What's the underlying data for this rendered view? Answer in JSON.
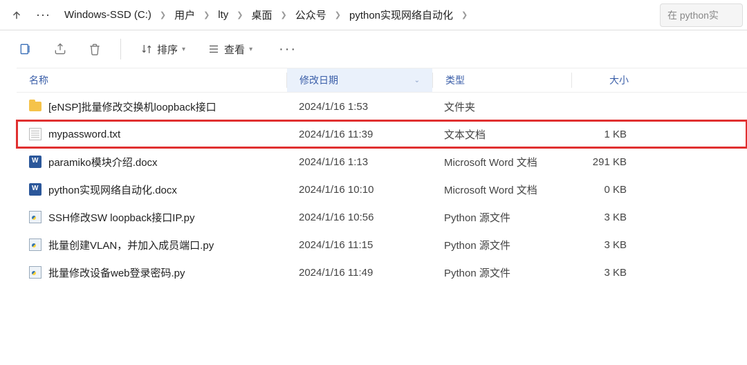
{
  "breadcrumb": {
    "items": [
      {
        "label": "Windows-SSD (C:)"
      },
      {
        "label": "用户"
      },
      {
        "label": "lty"
      },
      {
        "label": "桌面"
      },
      {
        "label": "公众号"
      },
      {
        "label": "python实现网络自动化"
      }
    ],
    "overflow": "···"
  },
  "search": {
    "placeholder": "在 python实"
  },
  "toolbar": {
    "sort_label": "排序",
    "view_label": "查看",
    "more": "···"
  },
  "columns": {
    "name": "名称",
    "date": "修改日期",
    "type": "类型",
    "size": "大小"
  },
  "files": [
    {
      "icon": "folder",
      "name": "[eNSP]批量修改交换机loopback接口",
      "date": "2024/1/16 1:53",
      "type": "文件夹",
      "size": "",
      "highlight": false
    },
    {
      "icon": "txt",
      "name": "mypassword.txt",
      "date": "2024/1/16 11:39",
      "type": "文本文档",
      "size": "1 KB",
      "highlight": true
    },
    {
      "icon": "docx",
      "name": "paramiko模块介绍.docx",
      "date": "2024/1/16 1:13",
      "type": "Microsoft Word 文档",
      "size": "291 KB",
      "highlight": false
    },
    {
      "icon": "docx",
      "name": "python实现网络自动化.docx",
      "date": "2024/1/16 10:10",
      "type": "Microsoft Word 文档",
      "size": "0 KB",
      "highlight": false
    },
    {
      "icon": "py",
      "name": "SSH修改SW loopback接口IP.py",
      "date": "2024/1/16 10:56",
      "type": "Python 源文件",
      "size": "3 KB",
      "highlight": false
    },
    {
      "icon": "py",
      "name": "批量创建VLAN，并加入成员端口.py",
      "date": "2024/1/16 11:15",
      "type": "Python 源文件",
      "size": "3 KB",
      "highlight": false
    },
    {
      "icon": "py",
      "name": "批量修改设备web登录密码.py",
      "date": "2024/1/16 11:49",
      "type": "Python 源文件",
      "size": "3 KB",
      "highlight": false
    }
  ]
}
